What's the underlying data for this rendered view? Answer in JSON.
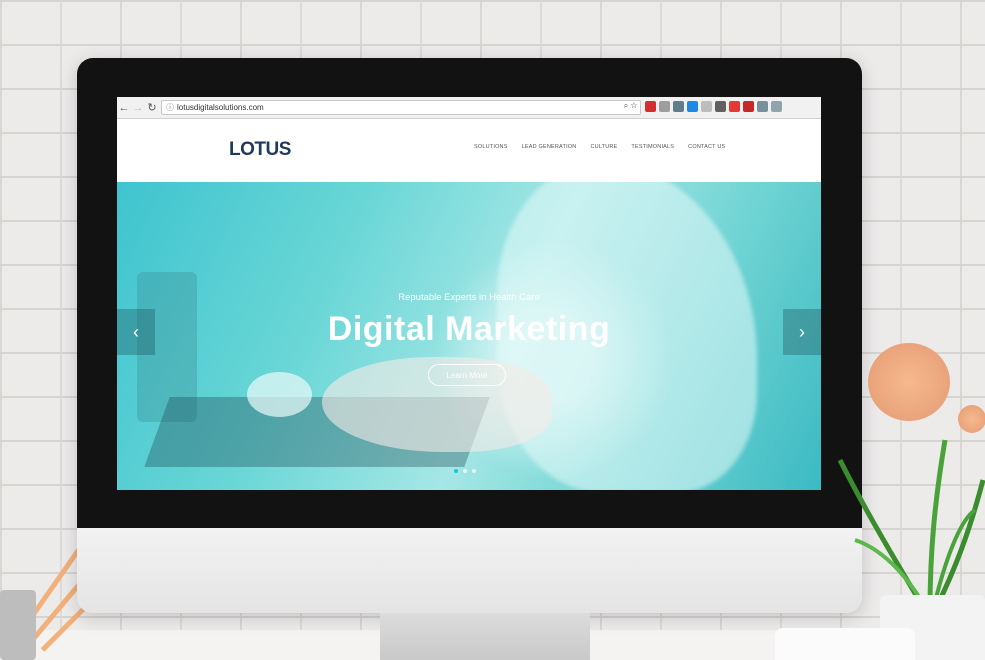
{
  "browser": {
    "url": "lotusdigitalsolutions.com"
  },
  "site": {
    "logo_text": "LOTUS",
    "nav": [
      "SOLUTIONS",
      "LEAD GENERATION",
      "CULTURE",
      "TESTIMONIALS",
      "CONTACT US"
    ]
  },
  "hero": {
    "kicker": "Reputable Experts in Health Care",
    "headline": "Digital Marketing",
    "cta": "Learn More",
    "prev": "‹",
    "next": "›",
    "slides_total": 3,
    "active_slide": 1
  },
  "colors": {
    "brand_dark": "#1f3a5a",
    "brand_accent": "#29c4d6",
    "hero_teal": "#3fc4cf"
  }
}
